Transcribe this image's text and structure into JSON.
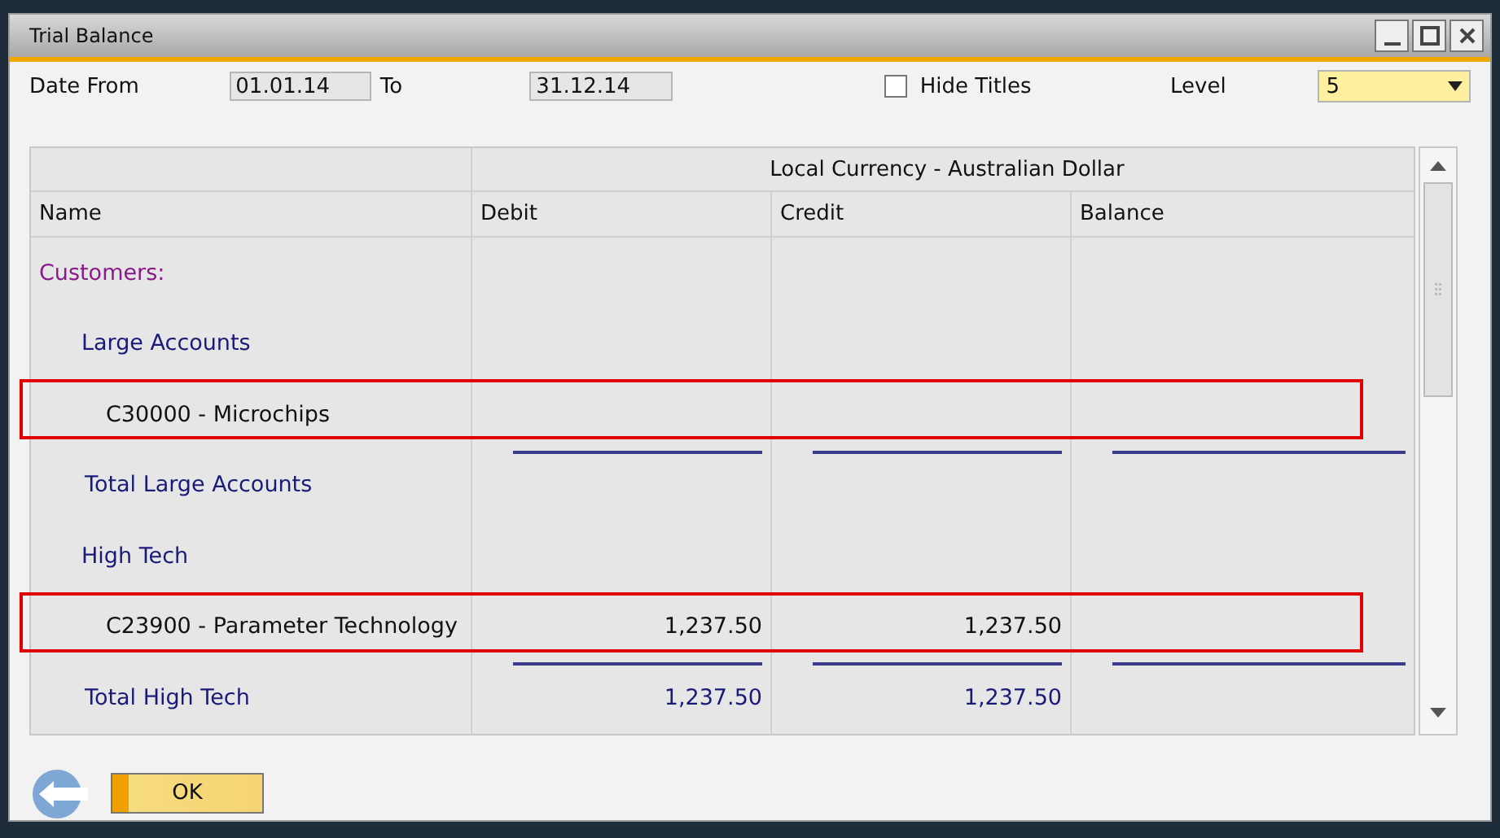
{
  "window": {
    "title": "Trial Balance"
  },
  "filters": {
    "date_from_label": "Date From",
    "date_from": "01.01.14",
    "to_label": "To",
    "date_to": "31.12.14",
    "hide_titles": {
      "label": "Hide Titles",
      "checked": false
    },
    "level_label": "Level",
    "level": "5"
  },
  "table": {
    "currency_header": "Local Currency - Australian Dollar",
    "columns": [
      "Name",
      "Debit",
      "Credit",
      "Balance"
    ],
    "rows": [
      {
        "kind": "category",
        "name": "Customers:",
        "highlighted": false,
        "children": [
          {
            "kind": "group",
            "name": "Large Accounts",
            "highlighted": false,
            "children": [
              {
                "kind": "account",
                "name": "C30000 - Microchips",
                "highlighted": true
              }
            ]
          },
          {
            "kind": "total",
            "name": "Total Large Accounts",
            "highlighted": false
          },
          {
            "kind": "group",
            "name": "High Tech",
            "highlighted": false,
            "children": [
              {
                "kind": "account",
                "name": "C23900 - Parameter Technology",
                "debit": "1,237.50",
                "credit": "1,237.50",
                "highlighted": true
              }
            ]
          },
          {
            "kind": "total",
            "name": "Total High Tech",
            "debit": "1,237.50",
            "credit": "1,237.50",
            "highlighted": false
          }
        ]
      }
    ]
  },
  "buttons": {
    "ok": "OK"
  }
}
